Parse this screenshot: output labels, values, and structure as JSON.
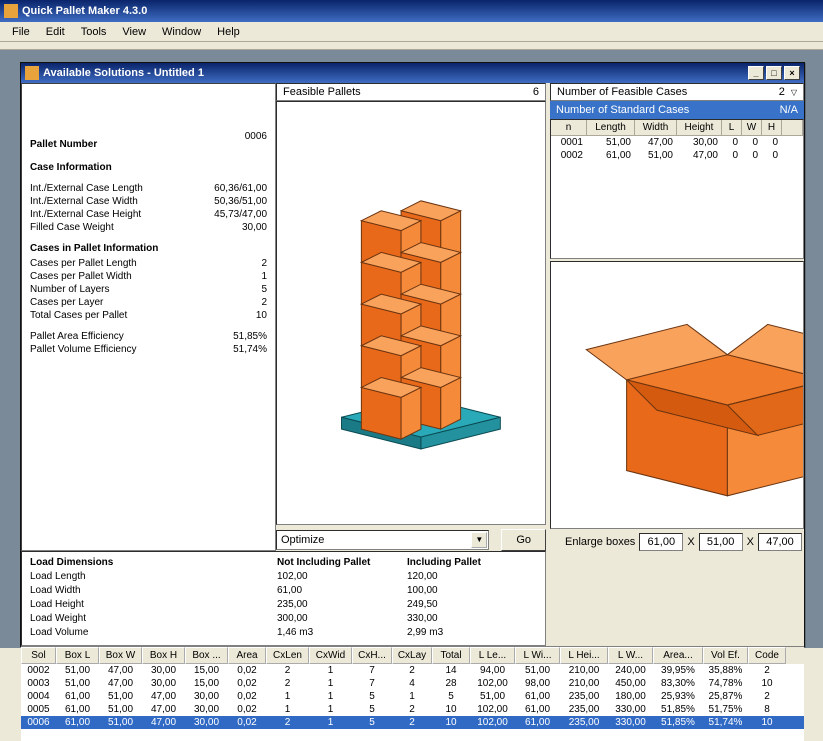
{
  "app": {
    "title": "Quick Pallet Maker 4.3.0"
  },
  "menu": [
    "File",
    "Edit",
    "Tools",
    "View",
    "Window",
    "Help"
  ],
  "child": {
    "title": "Available Solutions - Untitled 1",
    "feasible_label": "Feasible Pallets",
    "feasible_count": "6",
    "cases_label": "Number of Feasible Cases",
    "cases_count": "2",
    "std_label": "Number of Standard Cases",
    "std_count": "N/A"
  },
  "info": {
    "pallet_num_label": "Pallet Number",
    "pallet_num": "0006",
    "case_hdr": "Case Information",
    "r1l": "Int./External Case Length",
    "r1v": "60,36/61,00",
    "r2l": "Int./External Case Width",
    "r2v": "50,36/51,00",
    "r3l": "Int./External Case Height",
    "r3v": "45,73/47,00",
    "r4l": "Filled Case Weight",
    "r4v": "30,00",
    "pal_hdr": "Cases in Pallet Information",
    "p1l": "Cases per Pallet Length",
    "p1v": "2",
    "p2l": "Cases per Pallet Width",
    "p2v": "1",
    "p3l": "Number of Layers",
    "p3v": "5",
    "p4l": "Cases per Layer",
    "p4v": "2",
    "p5l": "Total Cases per Pallet",
    "p5v": "10",
    "e1l": "Pallet Area Efficiency",
    "e1v": "51,85%",
    "e2l": "Pallet Volume Efficiency",
    "e2v": "51,74%"
  },
  "optimize": {
    "label": "Optimize",
    "go": "Go"
  },
  "cases_table": {
    "cols": [
      "n",
      "Length",
      "Width",
      "Height",
      "L",
      "W",
      "H"
    ],
    "rows": [
      [
        "0001",
        "51,00",
        "47,00",
        "30,00",
        "0",
        "0",
        "0"
      ],
      [
        "0002",
        "61,00",
        "51,00",
        "47,00",
        "0",
        "0",
        "0"
      ]
    ]
  },
  "enlarge": {
    "label": "Enlarge boxes",
    "x": "X",
    "v1": "61,00",
    "v2": "51,00",
    "v3": "47,00"
  },
  "load": {
    "hdr": "Load Dimensions",
    "c1": "Not Including Pallet",
    "c2": "Including Pallet",
    "rows": [
      [
        "Load Length",
        "102,00",
        "120,00"
      ],
      [
        "Load Width",
        "61,00",
        "100,00"
      ],
      [
        "Load Height",
        "235,00",
        "249,50"
      ],
      [
        "Load Weight",
        "300,00",
        "330,00"
      ],
      [
        "Load Volume",
        "1,46 m3",
        "2,99 m3"
      ]
    ]
  },
  "grid": {
    "cols": [
      "Sol",
      "Box L",
      "Box W",
      "Box H",
      "Box ...",
      "Area",
      "CxLen",
      "CxWid",
      "CxH...",
      "CxLay",
      "Total",
      "L Le...",
      "L Wi...",
      "L Hei...",
      "L W...",
      "Area...",
      "Vol Ef.",
      "Code"
    ],
    "rows": [
      [
        "0002",
        "51,00",
        "47,00",
        "30,00",
        "15,00",
        "0,02",
        "2",
        "1",
        "7",
        "2",
        "14",
        "94,00",
        "51,00",
        "210,00",
        "240,00",
        "39,95%",
        "35,88%",
        "2"
      ],
      [
        "0003",
        "51,00",
        "47,00",
        "30,00",
        "15,00",
        "0,02",
        "2",
        "1",
        "7",
        "4",
        "28",
        "102,00",
        "98,00",
        "210,00",
        "450,00",
        "83,30%",
        "74,78%",
        "10"
      ],
      [
        "0004",
        "61,00",
        "51,00",
        "47,00",
        "30,00",
        "0,02",
        "1",
        "1",
        "5",
        "1",
        "5",
        "51,00",
        "61,00",
        "235,00",
        "180,00",
        "25,93%",
        "25,87%",
        "2"
      ],
      [
        "0005",
        "61,00",
        "51,00",
        "47,00",
        "30,00",
        "0,02",
        "1",
        "1",
        "5",
        "2",
        "10",
        "102,00",
        "61,00",
        "235,00",
        "330,00",
        "51,85%",
        "51,75%",
        "8"
      ],
      [
        "0006",
        "61,00",
        "51,00",
        "47,00",
        "30,00",
        "0,02",
        "2",
        "1",
        "5",
        "2",
        "10",
        "102,00",
        "61,00",
        "235,00",
        "330,00",
        "51,85%",
        "51,74%",
        "10"
      ]
    ],
    "selected": 4
  }
}
